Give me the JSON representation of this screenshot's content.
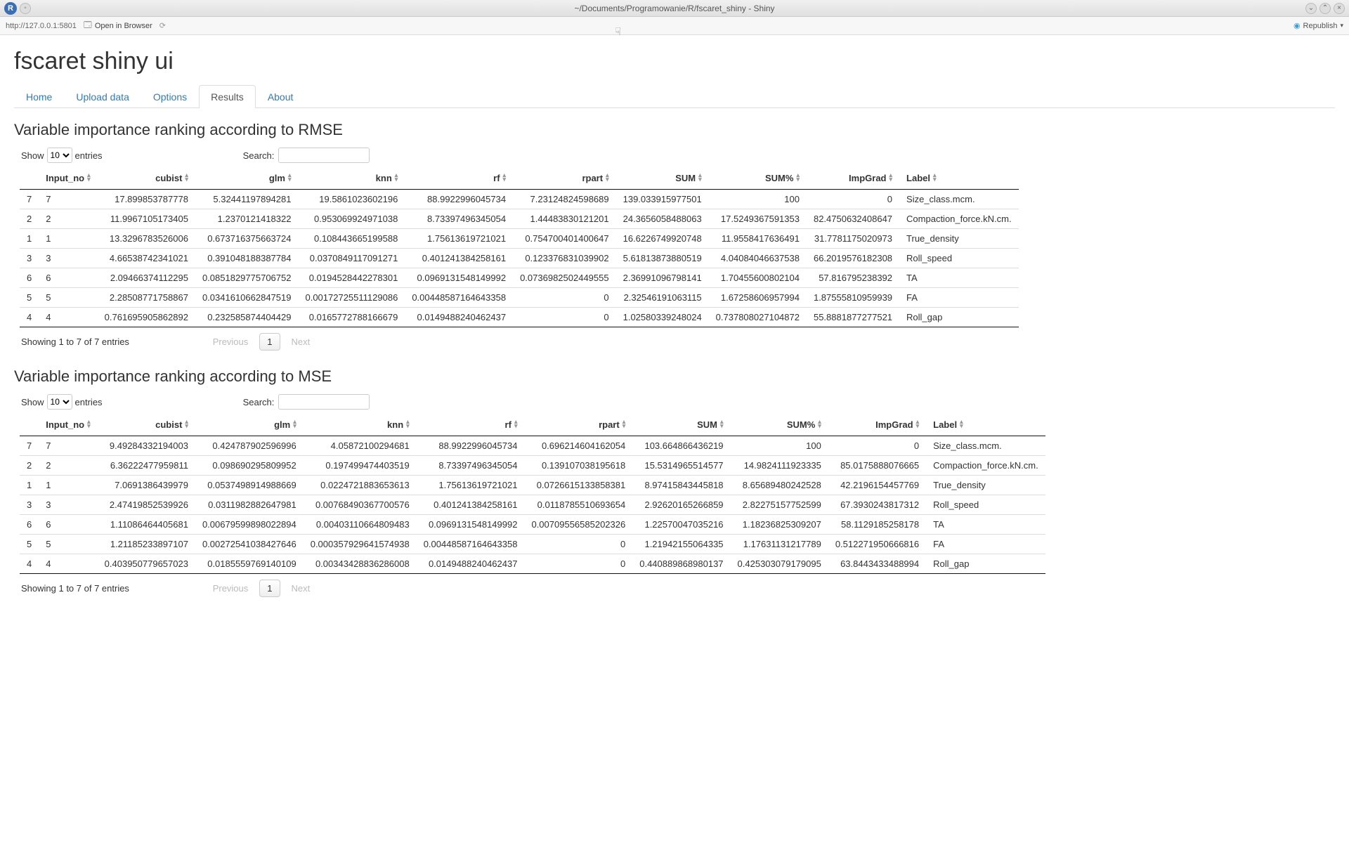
{
  "window": {
    "title": "~/Documents/Programowanie/R/fscaret_shiny - Shiny"
  },
  "toolbar": {
    "url": "http://127.0.0.1:5801",
    "open_in_browser": "Open in Browser",
    "republish": "Republish"
  },
  "page": {
    "title": "fscaret shiny ui"
  },
  "tabs": [
    {
      "label": "Home",
      "active": false
    },
    {
      "label": "Upload data",
      "active": false
    },
    {
      "label": "Options",
      "active": false
    },
    {
      "label": "Results",
      "active": true
    },
    {
      "label": "About",
      "active": false
    }
  ],
  "dt_common": {
    "show_label_pre": "Show",
    "show_label_post": "entries",
    "entries_value": "10",
    "search_label": "Search:",
    "info": "Showing 1 to 7 of 7 entries",
    "prev": "Previous",
    "next": "Next",
    "page1": "1"
  },
  "section1": {
    "title": "Variable importance ranking according to RMSE",
    "columns": [
      "",
      "Input_no",
      "cubist",
      "glm",
      "knn",
      "rf",
      "rpart",
      "SUM",
      "SUM%",
      "ImpGrad",
      "Label"
    ],
    "rows": [
      {
        "idx": "7",
        "input_no": "7",
        "cubist": "17.899853787778",
        "glm": "5.32441197894281",
        "knn": "19.5861023602196",
        "rf": "88.9922996045734",
        "rpart": "7.23124824598689",
        "sum": "139.033915977501",
        "sumpct": "100",
        "impgrad": "0",
        "label": "Size_class.mcm."
      },
      {
        "idx": "2",
        "input_no": "2",
        "cubist": "11.9967105173405",
        "glm": "1.2370121418322",
        "knn": "0.953069924971038",
        "rf": "8.73397496345054",
        "rpart": "1.44483830121201",
        "sum": "24.3656058488063",
        "sumpct": "17.5249367591353",
        "impgrad": "82.4750632408647",
        "label": "Compaction_force.kN.cm."
      },
      {
        "idx": "1",
        "input_no": "1",
        "cubist": "13.3296783526006",
        "glm": "0.673716375663724",
        "knn": "0.108443665199588",
        "rf": "1.75613619721021",
        "rpart": "0.754700401400647",
        "sum": "16.6226749920748",
        "sumpct": "11.9558417636491",
        "impgrad": "31.7781175020973",
        "label": "True_density"
      },
      {
        "idx": "3",
        "input_no": "3",
        "cubist": "4.66538742341021",
        "glm": "0.391048188387784",
        "knn": "0.0370849117091271",
        "rf": "0.401241384258161",
        "rpart": "0.123376831039902",
        "sum": "5.61813873880519",
        "sumpct": "4.04084046637538",
        "impgrad": "66.2019576182308",
        "label": "Roll_speed"
      },
      {
        "idx": "6",
        "input_no": "6",
        "cubist": "2.09466374112295",
        "glm": "0.0851829775706752",
        "knn": "0.0194528442278301",
        "rf": "0.0969131548149992",
        "rpart": "0.0736982502449555",
        "sum": "2.36991096798141",
        "sumpct": "1.70455600802104",
        "impgrad": "57.816795238392",
        "label": "TA"
      },
      {
        "idx": "5",
        "input_no": "5",
        "cubist": "2.28508771758867",
        "glm": "0.0341610662847519",
        "knn": "0.00172725511129086",
        "rf": "0.00448587164643358",
        "rpart": "0",
        "sum": "2.32546191063115",
        "sumpct": "1.67258606957994",
        "impgrad": "1.87555810959939",
        "label": "FA"
      },
      {
        "idx": "4",
        "input_no": "4",
        "cubist": "0.761695905862892",
        "glm": "0.232585874404429",
        "knn": "0.0165772788166679",
        "rf": "0.0149488240462437",
        "rpart": "0",
        "sum": "1.02580339248024",
        "sumpct": "0.737808027104872",
        "impgrad": "55.8881877277521",
        "label": "Roll_gap"
      }
    ]
  },
  "section2": {
    "title": "Variable importance ranking according to MSE",
    "columns": [
      "",
      "Input_no",
      "cubist",
      "glm",
      "knn",
      "rf",
      "rpart",
      "SUM",
      "SUM%",
      "ImpGrad",
      "Label"
    ],
    "rows": [
      {
        "idx": "7",
        "input_no": "7",
        "cubist": "9.49284332194003",
        "glm": "0.424787902596996",
        "knn": "4.05872100294681",
        "rf": "88.9922996045734",
        "rpart": "0.696214604162054",
        "sum": "103.664866436219",
        "sumpct": "100",
        "impgrad": "0",
        "label": "Size_class.mcm."
      },
      {
        "idx": "2",
        "input_no": "2",
        "cubist": "6.36222477959811",
        "glm": "0.098690295809952",
        "knn": "0.197499474403519",
        "rf": "8.73397496345054",
        "rpart": "0.139107038195618",
        "sum": "15.5314965514577",
        "sumpct": "14.9824111923335",
        "impgrad": "85.0175888076665",
        "label": "Compaction_force.kN.cm."
      },
      {
        "idx": "1",
        "input_no": "1",
        "cubist": "7.0691386439979",
        "glm": "0.0537498914988669",
        "knn": "0.0224721883653613",
        "rf": "1.75613619721021",
        "rpart": "0.0726615133858381",
        "sum": "8.97415843445818",
        "sumpct": "8.65689480242528",
        "impgrad": "42.2196154457769",
        "label": "True_density"
      },
      {
        "idx": "3",
        "input_no": "3",
        "cubist": "2.47419852539926",
        "glm": "0.0311982882647981",
        "knn": "0.00768490367700576",
        "rf": "0.401241384258161",
        "rpart": "0.0118785510693654",
        "sum": "2.92620165266859",
        "sumpct": "2.82275157752599",
        "impgrad": "67.3930243817312",
        "label": "Roll_speed"
      },
      {
        "idx": "6",
        "input_no": "6",
        "cubist": "1.11086464405681",
        "glm": "0.00679599898022894",
        "knn": "0.00403110664809483",
        "rf": "0.0969131548149992",
        "rpart": "0.00709556585202326",
        "sum": "1.22570047035216",
        "sumpct": "1.18236825309207",
        "impgrad": "58.1129185258178",
        "label": "TA"
      },
      {
        "idx": "5",
        "input_no": "5",
        "cubist": "1.21185233897107",
        "glm": "0.00272541038427646",
        "knn": "0.000357929641574938",
        "rf": "0.00448587164643358",
        "rpart": "0",
        "sum": "1.21942155064335",
        "sumpct": "1.17631131217789",
        "impgrad": "0.512271950666816",
        "label": "FA"
      },
      {
        "idx": "4",
        "input_no": "4",
        "cubist": "0.403950779657023",
        "glm": "0.0185559769140109",
        "knn": "0.00343428836286008",
        "rf": "0.0149488240462437",
        "rpart": "0",
        "sum": "0.440889868980137",
        "sumpct": "0.425303079179095",
        "impgrad": "63.8443433488994",
        "label": "Roll_gap"
      }
    ]
  }
}
